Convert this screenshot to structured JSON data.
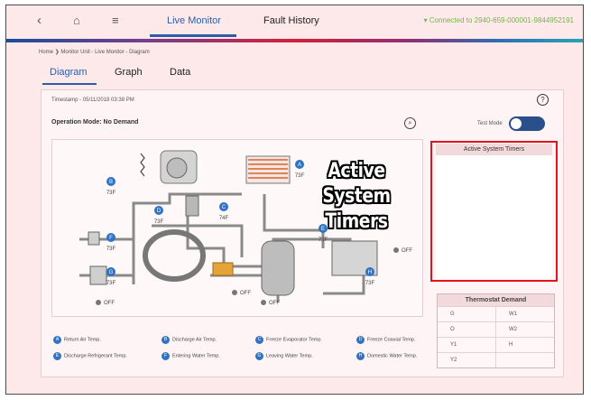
{
  "topbar": {
    "back_icon": "chevron-left-icon",
    "home_icon": "home-icon",
    "menu_icon": "hamburger-menu-icon",
    "tabs": [
      {
        "label": "Live Monitor",
        "active": true
      },
      {
        "label": "Fault History",
        "active": false
      }
    ],
    "connection": {
      "icon": "wifi-icon",
      "text": "Connected to 2940-659-000001-9844952191"
    }
  },
  "breadcrumb": {
    "home": "Home",
    "path": "Monitor Unit - Live Monitor - Diagram"
  },
  "subtabs": [
    {
      "label": "Diagram",
      "active": true
    },
    {
      "label": "Graph",
      "active": false
    },
    {
      "label": "Data",
      "active": false
    }
  ],
  "main": {
    "timestamp": "Timestamp - 05/11/2018 03:38 PM",
    "operation_mode": "Operation Mode: No Demand",
    "test_mode_label": "Test Mode",
    "help_icon": "question-icon",
    "zoom_icon": "magnifier-icon"
  },
  "diagram": {
    "sensors": [
      {
        "letter": "A",
        "value": "73F"
      },
      {
        "letter": "B",
        "value": "73F"
      },
      {
        "letter": "C",
        "value": "74F"
      },
      {
        "letter": "D",
        "value": "73F"
      },
      {
        "letter": "E",
        "value": "73F"
      },
      {
        "letter": "F",
        "value": "73F"
      },
      {
        "letter": "G",
        "value": "73F"
      },
      {
        "letter": "H",
        "value": "73F"
      }
    ],
    "off_labels": [
      "OFF",
      "OFF",
      "OFF",
      "OFF"
    ]
  },
  "overlay_label": [
    "Active",
    "System",
    "Timers"
  ],
  "timers_panel": {
    "title": "Active System Timers",
    "highlight_color": "#e2141e"
  },
  "thermostat": {
    "title": "Thermostat Demand",
    "rows": [
      [
        "G",
        "W1"
      ],
      [
        "O",
        "W2"
      ],
      [
        "Y1",
        "H"
      ],
      [
        "Y2",
        ""
      ]
    ]
  },
  "legend": [
    {
      "letter": "A",
      "label": "Return Air Temp."
    },
    {
      "letter": "B",
      "label": "Discharge Air Temp."
    },
    {
      "letter": "C",
      "label": "Freeze Evaporator Temp."
    },
    {
      "letter": "D",
      "label": "Freeze Coaxial Temp."
    },
    {
      "letter": "E",
      "label": "Discharge Refrigerant Temp."
    },
    {
      "letter": "F",
      "label": "Entering Water Temp."
    },
    {
      "letter": "G",
      "label": "Leaving Water Temp."
    },
    {
      "letter": "H",
      "label": "Domestic Water Temp."
    }
  ],
  "colors": {
    "accent": "#2d5da8",
    "connected": "#77b24d",
    "sensor": "#2f73c4",
    "page_bg": "#fde9ea"
  }
}
